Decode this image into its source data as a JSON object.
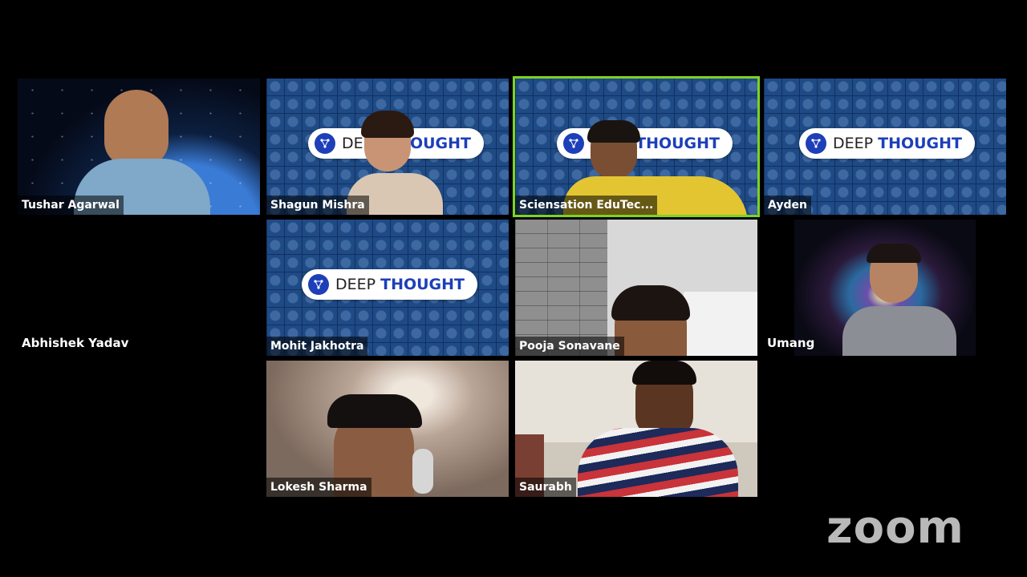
{
  "participants": [
    {
      "name": "Tushar Agarwal"
    },
    {
      "name": "Shagun Mishra"
    },
    {
      "name": "Sciensation EduTec..."
    },
    {
      "name": "Ayden"
    },
    {
      "name": "Abhishek Yadav"
    },
    {
      "name": "Mohit Jakhotra"
    },
    {
      "name": "Pooja Sonavane"
    },
    {
      "name": "Umang"
    },
    {
      "name": "Lokesh Sharma"
    },
    {
      "name": "Saurabh"
    }
  ],
  "background": {
    "deep": "DEEP",
    "thought": "THOUGHT"
  },
  "brand": {
    "logo_text": "zoom"
  },
  "colors": {
    "active_speaker": "#7ed321",
    "brand_blue": "#1d3fb8"
  }
}
